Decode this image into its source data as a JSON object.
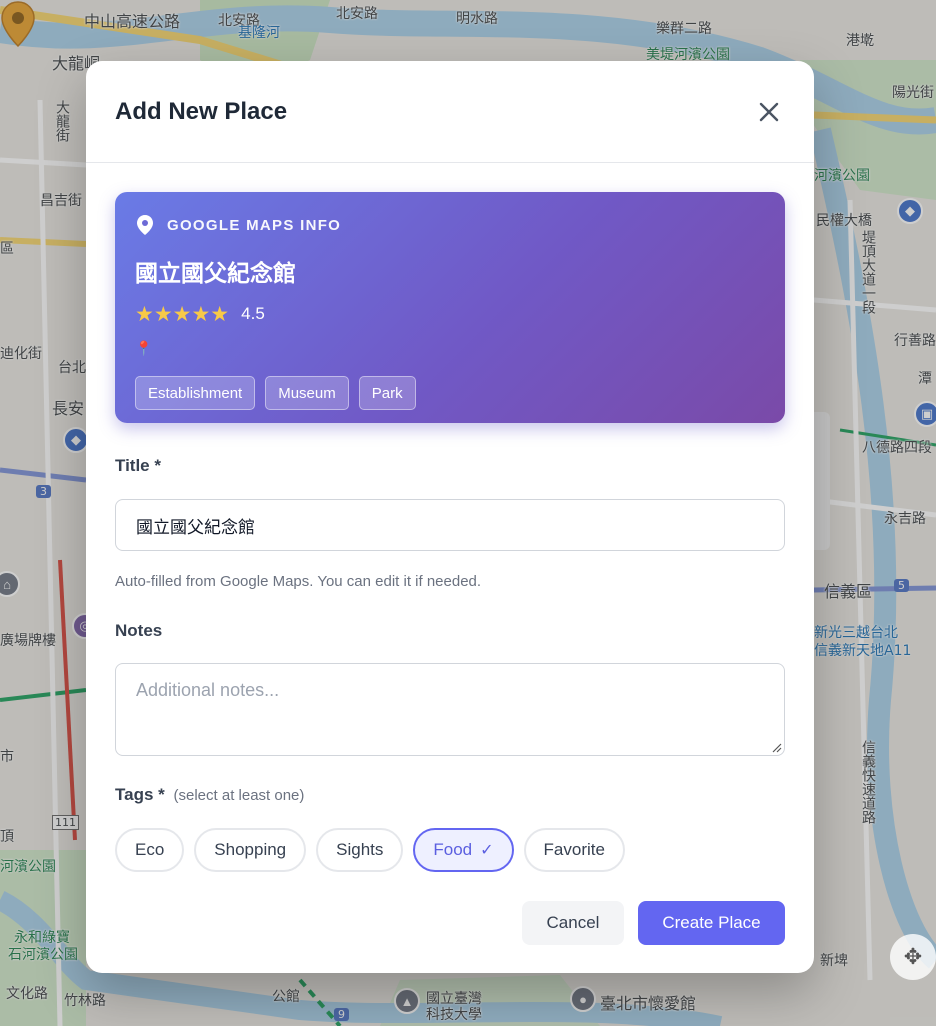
{
  "map": {
    "labels": {
      "l1": "中山高速公路",
      "l2": "北安路",
      "l3": "北安路",
      "l4": "明水路",
      "l5": "樂群二路",
      "l6": "港墘",
      "l7": "美堤河濱公園",
      "l8": "基隆河",
      "l9": "大龍峒",
      "l10": "大龍街",
      "l11": "昌吉街",
      "l12": "河濱公園",
      "l13": "陽光街",
      "l14": "民權大橋",
      "l15": "堤頂大道一段",
      "l16": "行善路",
      "l17": "潭",
      "l18": "迪化街",
      "l19": "台北",
      "l20": "長安",
      "l21": "八德路四段",
      "l22": "永吉路",
      "l23": "信義區",
      "l24": "廣場牌樓",
      "l25": "新光三越台北",
      "l26": "信義新天地A11",
      "l27": "信義快速道路",
      "l28": "河濱公園",
      "l29": "永和綠寶",
      "l30": "石河濱公園",
      "l31": "文化路",
      "l32": "竹林路",
      "l33": "公館",
      "l34": "國立臺灣",
      "l35": "科技大學",
      "l36": "臺北市懷愛館",
      "l37": "新埤",
      "l38": "區",
      "l39": "頂",
      "l40": "市",
      "l41": "111",
      "l42": "5",
      "l43": "3",
      "l44": "9"
    }
  },
  "modal": {
    "title": "Add New Place",
    "info_card": {
      "header_label": "GOOGLE MAPS INFO",
      "place_name": "國立國父紀念館",
      "stars": "★★★★★",
      "rating": "4.5",
      "address_icon": "📍",
      "types": [
        "Establishment",
        "Museum",
        "Park"
      ]
    },
    "title_field": {
      "label": "Title *",
      "value": "國立國父紀念館",
      "help": "Auto-filled from Google Maps. You can edit it if needed."
    },
    "notes_field": {
      "label": "Notes",
      "placeholder": "Additional notes..."
    },
    "tags_field": {
      "label": "Tags *",
      "sub": "(select at least one)",
      "tags": [
        "Eco",
        "Shopping",
        "Sights",
        "Food",
        "Favorite"
      ],
      "selected": "Food",
      "check": "✓"
    },
    "buttons": {
      "cancel": "Cancel",
      "create": "Create Place"
    }
  },
  "colors": {
    "accent": "#6366f1",
    "card_gradient_start": "#6a7be6",
    "card_gradient_end": "#7a4aa8",
    "star": "#f7c948"
  }
}
